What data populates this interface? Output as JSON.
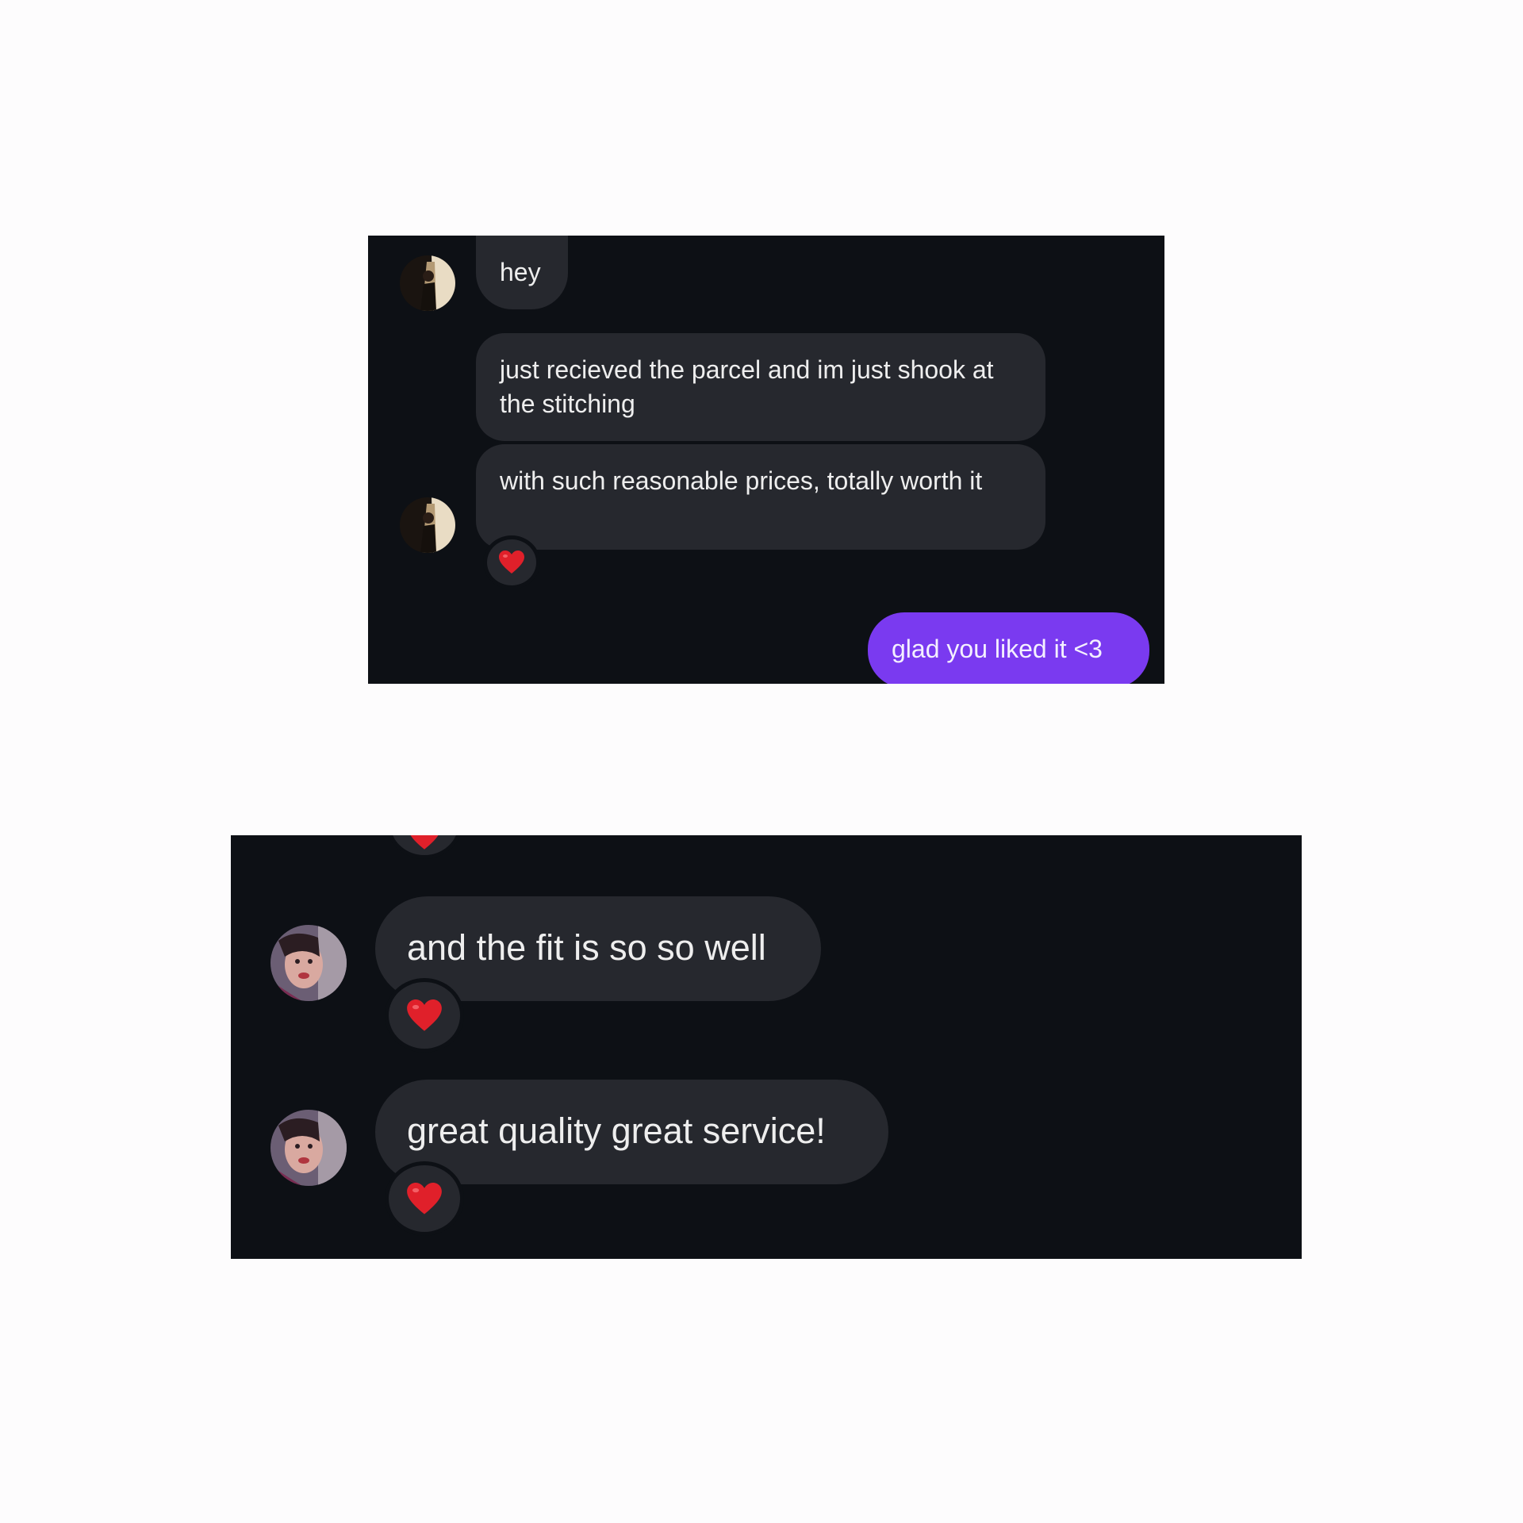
{
  "screenshot_top": {
    "messages": [
      {
        "text": "hey",
        "direction": "incoming"
      },
      {
        "text": "just recieved the parcel and im just shook at the stitching",
        "direction": "incoming"
      },
      {
        "text": "with such reasonable prices, totally worth it",
        "direction": "incoming",
        "reaction": "heart-icon"
      },
      {
        "text": "glad you liked it <3",
        "direction": "outgoing"
      }
    ]
  },
  "screenshot_bottom": {
    "messages": [
      {
        "text": "and the fit is so so well",
        "direction": "incoming",
        "reaction": "heart-icon"
      },
      {
        "text": "great quality great service!",
        "direction": "incoming",
        "reaction": "heart-icon"
      }
    ]
  },
  "colors": {
    "page_background": "#fdfcfd",
    "chat_background": "#0d1015",
    "incoming_bubble": "#26282e",
    "outgoing_bubble": "#7a3af0",
    "reaction_heart": "#e0202a"
  }
}
